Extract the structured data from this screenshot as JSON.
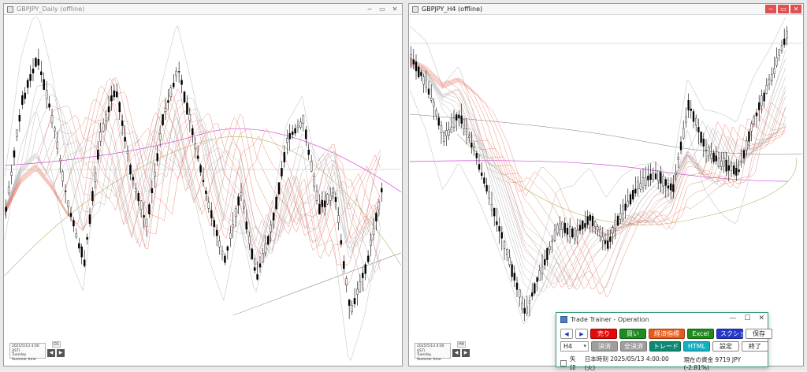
{
  "left_chart": {
    "title": "GBPJPY_Daily (offline)",
    "info_lines": [
      "2025/5/13 4:00 (JST)",
      "Tuesday",
      "Summer time"
    ],
    "corner_label": "D1",
    "controls": [
      "−",
      "▭",
      "✕"
    ]
  },
  "right_chart": {
    "title": "GBPJPY_H4 (offline)",
    "info_lines": [
      "2025/5/13 4:00 (JST)",
      "Tuesday",
      "Summer time"
    ],
    "corner_label": "H4",
    "controls": [
      "−",
      "▭",
      "✕"
    ]
  },
  "trade_trainer": {
    "title": "Trade Trainer - Operation",
    "window_controls": [
      "—",
      "☐",
      "✕"
    ],
    "prev": "◀",
    "next": "▶",
    "sell": "売り",
    "buy": "買い",
    "econ": "経済指標",
    "excel": "Excel",
    "screenshot": "スクショ",
    "save": "保存",
    "timeframe": "H4",
    "settle": "決済",
    "settle_all": "全決済",
    "trade": "トレード",
    "html": "HTML",
    "settings": "設定",
    "exit": "終了",
    "arrow_checkbox_label": "矢印",
    "time_text": "日本時刻 2025/05/13 4:00:00 (火)",
    "balance_text": "現在の資金 9719 JPY (-2.81%)"
  },
  "colors": {
    "candle": "#000000",
    "ma_red": "#e8735f",
    "ma_gray": "#9a9a9a",
    "magenta": "#d04ad8",
    "olive": "#b5b56a"
  }
}
